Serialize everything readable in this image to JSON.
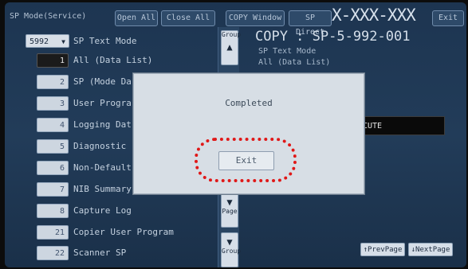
{
  "header": {
    "title": "SP Mode(Service)",
    "open_all": "Open All",
    "close_all": "Close All",
    "copy_window": "COPY Window",
    "sp_direct": "SP Direct",
    "model": "X-XXX-XXX",
    "exit": "Exit"
  },
  "mode": {
    "selected": "5992",
    "label": "SP Text Mode"
  },
  "sp_items": [
    {
      "num": "1",
      "label": "All (Data List)",
      "selected": true
    },
    {
      "num": "2",
      "label": "SP (Mode Da",
      "selected": false
    },
    {
      "num": "3",
      "label": "User Progra",
      "selected": false
    },
    {
      "num": "4",
      "label": "Logging Dat",
      "selected": false
    },
    {
      "num": "5",
      "label": "Diagnostic",
      "selected": false
    },
    {
      "num": "6",
      "label": "Non-Default",
      "selected": false
    },
    {
      "num": "7",
      "label": "NIB Summary",
      "selected": false
    },
    {
      "num": "8",
      "label": "Capture Log",
      "selected": false
    },
    {
      "num": "21",
      "label": "Copier User Program",
      "selected": false
    },
    {
      "num": "22",
      "label": "Scanner SP",
      "selected": false
    }
  ],
  "scroll": {
    "group_up": "Group",
    "page_down": "Page",
    "group_down": "Group"
  },
  "detail": {
    "title": "COPY : SP-5-992-001",
    "sub1": "SP Text Mode",
    "sub2": "All (Data List)",
    "execute": "CUTE",
    "prev_page": "↑PrevPage",
    "next_page": "↓NextPage"
  },
  "dialog": {
    "message": "Completed",
    "exit_label": "Exit"
  },
  "colors": {
    "highlight": "#e01818",
    "panel": "#223c59"
  }
}
